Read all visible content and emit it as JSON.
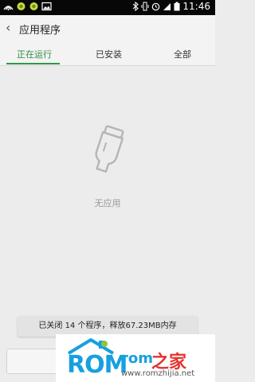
{
  "status_bar": {
    "time": "11:46",
    "icons": [
      "usb-icon",
      "notification-icon",
      "notification-icon",
      "image-icon",
      "bluetooth-icon",
      "vibrate-icon",
      "alarm-icon",
      "signal-icon",
      "battery-icon"
    ]
  },
  "app_bar": {
    "back_glyph": "‹",
    "title": "应用程序"
  },
  "tabs": [
    {
      "label": "正在运行",
      "active": true
    },
    {
      "label": "已安装",
      "active": false
    },
    {
      "label": "全部",
      "active": false
    }
  ],
  "empty_state": {
    "icon": "empty-bottle-icon",
    "text": "无应用"
  },
  "toast": {
    "text": "已关闭 14 个程序，释放67.23MB内存"
  },
  "watermark": {
    "brand": "ROM",
    "brand2": "rom",
    "brand_cn": "之家",
    "url": "www.romzhijia.net",
    "accent_color": "#17a0de"
  }
}
